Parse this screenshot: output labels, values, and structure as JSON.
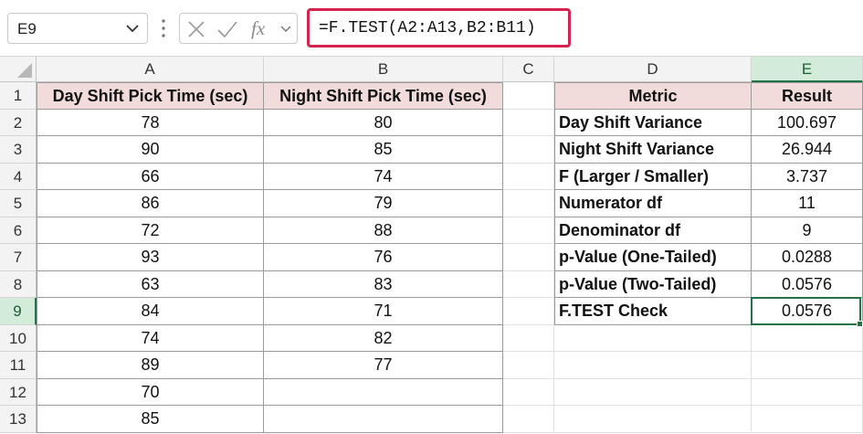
{
  "toolbar": {
    "name_box": "E9",
    "fx_label": "fx",
    "formula": "=F.TEST(A2:A13,B2:B11)"
  },
  "columns": [
    "A",
    "B",
    "C",
    "D",
    "E"
  ],
  "rows": [
    "1",
    "2",
    "3",
    "4",
    "5",
    "6",
    "7",
    "8",
    "9",
    "10",
    "11",
    "12",
    "13"
  ],
  "data_table": {
    "headers": [
      "Day Shift Pick Time (sec)",
      "Night Shift Pick Time (sec)"
    ],
    "day": [
      "78",
      "90",
      "66",
      "86",
      "72",
      "93",
      "63",
      "84",
      "74",
      "89",
      "70",
      "85"
    ],
    "night": [
      "80",
      "85",
      "74",
      "79",
      "88",
      "76",
      "83",
      "71",
      "82",
      "77"
    ]
  },
  "results_table": {
    "headers": [
      "Metric",
      "Result"
    ],
    "metrics": [
      "Day Shift Variance",
      "Night Shift Variance",
      "F (Larger / Smaller)",
      "Numerator df",
      "Denominator df",
      "p-Value (One-Tailed)",
      "p-Value (Two-Tailed)",
      "F.TEST Check"
    ],
    "results": [
      "100.697",
      "26.944",
      "3.737",
      "11",
      "9",
      "0.0288",
      "0.0576",
      "0.0576"
    ]
  },
  "colors": {
    "header_fill": "#f2dcdb",
    "selection": "#217346",
    "formula_highlight": "#d6224f"
  }
}
